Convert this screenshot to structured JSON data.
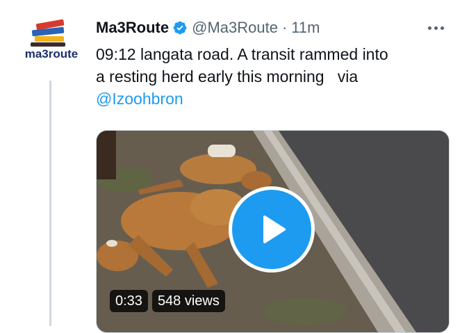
{
  "tweet": {
    "avatar": {
      "logo_text": "ma3route",
      "icon": "books-logo"
    },
    "author_name": "Ma3Route",
    "verified_icon": "verified-badge-icon",
    "handle": "@Ma3Route",
    "separator": "·",
    "time": "11m",
    "more_icon": "more-options-icon",
    "text_lines": [
      "09:12 langata road. A transit rammed into",
      "a resting herd early this morning   via"
    ],
    "mention": "@Izoohbron"
  },
  "video": {
    "duration": "0:33",
    "views": "548 views",
    "play_icon": "play-icon"
  },
  "colors": {
    "accent": "#1d9bf0",
    "text": "#0f1419",
    "muted": "#536471",
    "border": "#cfd9de"
  }
}
